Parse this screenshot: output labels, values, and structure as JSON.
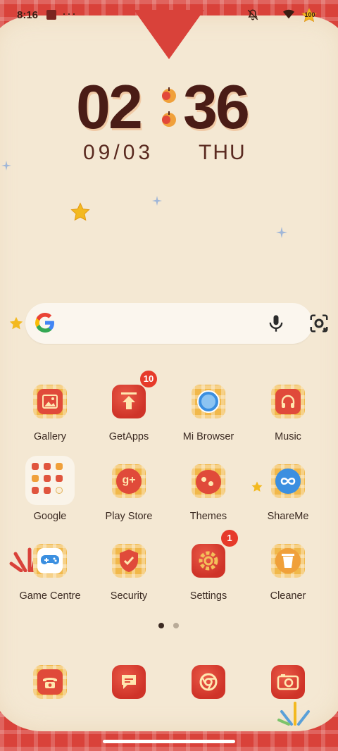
{
  "status": {
    "time": "8:16",
    "dots": "···",
    "battery": "100"
  },
  "clock": {
    "hours": "02",
    "minutes": "36",
    "date": "09/03",
    "day": "THU"
  },
  "search": {
    "placeholder": ""
  },
  "apps": [
    {
      "label": "Gallery",
      "badge": ""
    },
    {
      "label": "GetApps",
      "badge": "10"
    },
    {
      "label": "Mi Browser",
      "badge": ""
    },
    {
      "label": "Music",
      "badge": ""
    },
    {
      "label": "Google",
      "badge": ""
    },
    {
      "label": "Play Store",
      "badge": ""
    },
    {
      "label": "Themes",
      "badge": ""
    },
    {
      "label": "ShareMe",
      "badge": ""
    },
    {
      "label": "Game Centre",
      "badge": ""
    },
    {
      "label": "Security",
      "badge": ""
    },
    {
      "label": "Settings",
      "badge": "1"
    },
    {
      "label": "Cleaner",
      "badge": ""
    }
  ],
  "pager": {
    "pages": 2,
    "active": 1
  },
  "dock": [
    "phone-icon",
    "messaging-icon",
    "chrome-icon",
    "camera-icon"
  ],
  "colors": {
    "accent_red": "#d9423a",
    "badge_red": "#e63a2a",
    "clock_brown": "#4a1c16",
    "tile_yellow": "#f1b84a"
  }
}
